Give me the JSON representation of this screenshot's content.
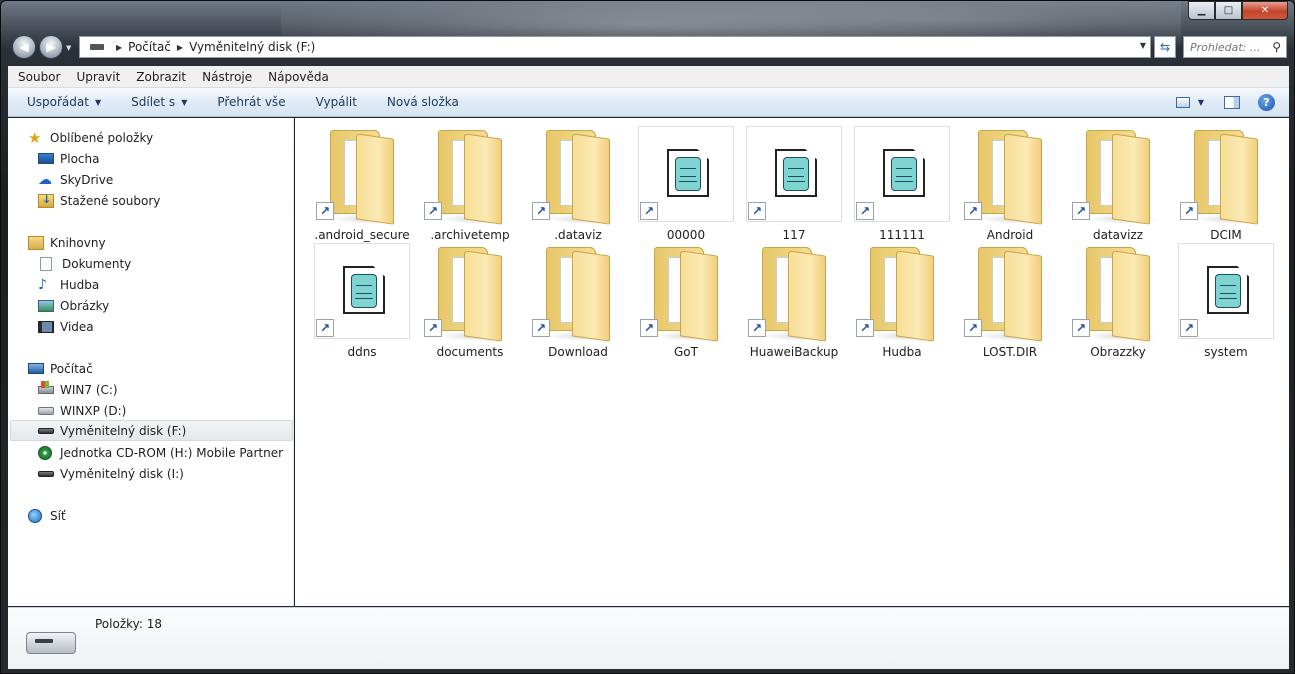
{
  "window": {
    "caption_buttons": [
      "minimize",
      "maximize",
      "close"
    ]
  },
  "address": {
    "breadcrumbs": [
      "Počítač",
      "Vyměnitelný disk (F:)"
    ]
  },
  "search": {
    "placeholder": "Prohledat: ..."
  },
  "menubar": {
    "items": [
      "Soubor",
      "Upravit",
      "Zobrazit",
      "Nástroje",
      "Nápověda"
    ]
  },
  "toolbar": {
    "organize": "Uspořádat",
    "share": "Sdílet s",
    "play_all": "Přehrát vše",
    "burn": "Vypálit",
    "new_folder": "Nová složka"
  },
  "navpane": {
    "favorites": {
      "label": "Oblíbené položky",
      "items": [
        "Plocha",
        "SkyDrive",
        "Stažené soubory"
      ]
    },
    "libraries": {
      "label": "Knihovny",
      "items": [
        "Dokumenty",
        "Hudba",
        "Obrázky",
        "Videa"
      ]
    },
    "computer": {
      "label": "Počítač",
      "items": [
        "WIN7 (C:)",
        "WINXP (D:)",
        "Vyměnitelný disk (F:)",
        "Jednotka CD-ROM (H:) Mobile Partner",
        "Vyměnitelný disk (I:)"
      ],
      "selected": "Vyměnitelný disk (F:)"
    },
    "network": {
      "label": "Síť"
    }
  },
  "content": {
    "items": [
      {
        "name": ".android_secure",
        "type": "folder"
      },
      {
        "name": ".archivetemp",
        "type": "folder"
      },
      {
        "name": ".dataviz",
        "type": "folder"
      },
      {
        "name": "00000",
        "type": "file"
      },
      {
        "name": "117",
        "type": "file"
      },
      {
        "name": "111111",
        "type": "file"
      },
      {
        "name": "Android",
        "type": "folder"
      },
      {
        "name": "datavizz",
        "type": "folder"
      },
      {
        "name": "DCIM",
        "type": "folder"
      },
      {
        "name": "ddns",
        "type": "file"
      },
      {
        "name": "documents",
        "type": "folder"
      },
      {
        "name": "Download",
        "type": "folder"
      },
      {
        "name": "GoT",
        "type": "folder"
      },
      {
        "name": "HuaweiBackup",
        "type": "folder"
      },
      {
        "name": "Hudba",
        "type": "folder"
      },
      {
        "name": "LOST.DIR",
        "type": "folder"
      },
      {
        "name": "Obrazzky",
        "type": "folder"
      },
      {
        "name": "system",
        "type": "file"
      }
    ]
  },
  "details": {
    "count_text": "Položky: 18"
  }
}
